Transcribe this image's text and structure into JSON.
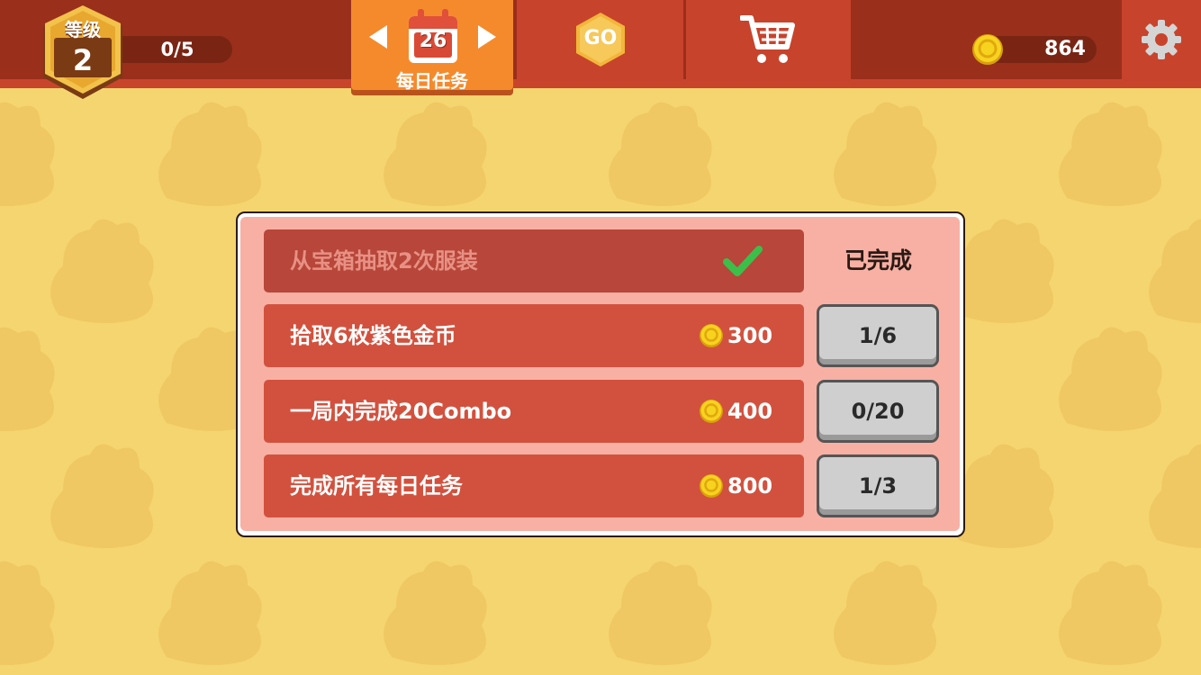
{
  "header": {
    "level_title": "等级",
    "level_number": "2",
    "xp_progress": "0/5",
    "calendar_day": "26",
    "daily_tab_label": "每日任务",
    "go_label": "GO",
    "coins": "864"
  },
  "tasks": [
    {
      "label": "从宝箱抽取2次服装",
      "status": "已完成",
      "completed": true
    },
    {
      "label": "拾取6枚紫色金币",
      "reward": "300",
      "progress": "1/6",
      "completed": false
    },
    {
      "label": "一局内完成20Combo",
      "reward": "400",
      "progress": "0/20",
      "completed": false
    },
    {
      "label": "完成所有每日任务",
      "reward": "800",
      "progress": "1/3",
      "completed": false
    }
  ],
  "icons": {
    "calendar": "calendar-icon",
    "go": "go-hexagon-icon",
    "shop": "shopping-cart-icon",
    "coin": "coin-icon",
    "settings": "gear-icon",
    "check": "checkmark-icon"
  },
  "colors": {
    "background": "#f5d56f",
    "top_bar": "#9a2f1c",
    "active_tab": "#f58a2d",
    "panel": "#f8b0a4",
    "task_row": "#d2513e",
    "task_row_done": "#b8463a",
    "check": "#3bbf4a",
    "coin": "#f2c21b"
  }
}
